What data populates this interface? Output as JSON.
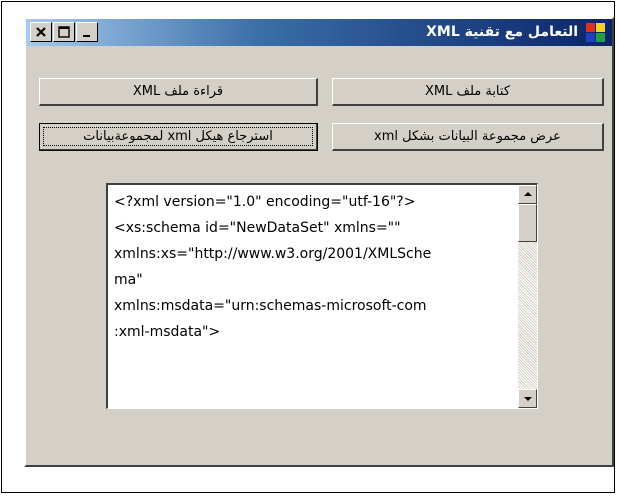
{
  "window": {
    "title": "التعامل مع تقنية XML",
    "colors": {
      "titlebar_dark": "#0a246a",
      "titlebar_light": "#a6caf0",
      "face": "#d4d0c8"
    },
    "icons": [
      "app-icon",
      "close-icon",
      "maximize-icon",
      "minimize-icon"
    ]
  },
  "buttons": {
    "write_xml": "كتابة ملف XML",
    "read_xml": "قراءة ملف XML",
    "show_dataset_xml": "عرض مجموعة البيانات بشكل xml",
    "get_schema": "استرجاع هيكل xml لمجموعةبيانات"
  },
  "textbox": {
    "value": "<?xml version=\"1.0\" encoding=\"utf-16\"?>\n<xs:schema id=\"NewDataSet\" xmlns=\"\"\nxmlns:xs=\"http://www.w3.org/2001/XMLSche\nma\"\nxmlns:msdata=\"urn:schemas-microsoft-com\n:xml-msdata\">"
  }
}
